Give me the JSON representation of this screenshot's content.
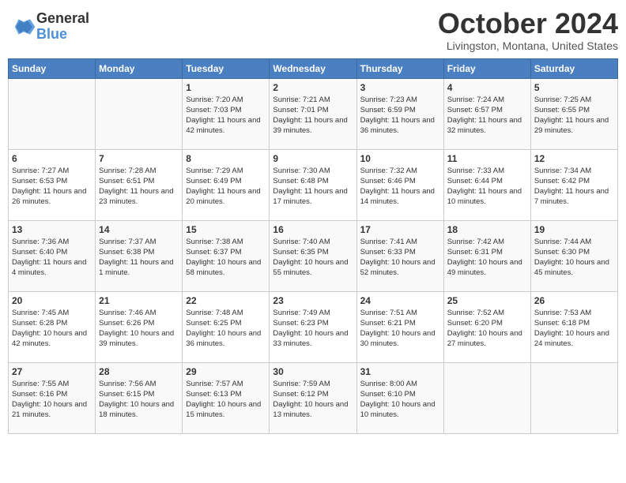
{
  "logo": {
    "general": "General",
    "blue": "Blue"
  },
  "title": "October 2024",
  "location": "Livingston, Montana, United States",
  "days_of_week": [
    "Sunday",
    "Monday",
    "Tuesday",
    "Wednesday",
    "Thursday",
    "Friday",
    "Saturday"
  ],
  "weeks": [
    [
      {
        "day": "",
        "sunrise": "",
        "sunset": "",
        "daylight": ""
      },
      {
        "day": "",
        "sunrise": "",
        "sunset": "",
        "daylight": ""
      },
      {
        "day": "1",
        "sunrise": "Sunrise: 7:20 AM",
        "sunset": "Sunset: 7:03 PM",
        "daylight": "Daylight: 11 hours and 42 minutes."
      },
      {
        "day": "2",
        "sunrise": "Sunrise: 7:21 AM",
        "sunset": "Sunset: 7:01 PM",
        "daylight": "Daylight: 11 hours and 39 minutes."
      },
      {
        "day": "3",
        "sunrise": "Sunrise: 7:23 AM",
        "sunset": "Sunset: 6:59 PM",
        "daylight": "Daylight: 11 hours and 36 minutes."
      },
      {
        "day": "4",
        "sunrise": "Sunrise: 7:24 AM",
        "sunset": "Sunset: 6:57 PM",
        "daylight": "Daylight: 11 hours and 32 minutes."
      },
      {
        "day": "5",
        "sunrise": "Sunrise: 7:25 AM",
        "sunset": "Sunset: 6:55 PM",
        "daylight": "Daylight: 11 hours and 29 minutes."
      }
    ],
    [
      {
        "day": "6",
        "sunrise": "Sunrise: 7:27 AM",
        "sunset": "Sunset: 6:53 PM",
        "daylight": "Daylight: 11 hours and 26 minutes."
      },
      {
        "day": "7",
        "sunrise": "Sunrise: 7:28 AM",
        "sunset": "Sunset: 6:51 PM",
        "daylight": "Daylight: 11 hours and 23 minutes."
      },
      {
        "day": "8",
        "sunrise": "Sunrise: 7:29 AM",
        "sunset": "Sunset: 6:49 PM",
        "daylight": "Daylight: 11 hours and 20 minutes."
      },
      {
        "day": "9",
        "sunrise": "Sunrise: 7:30 AM",
        "sunset": "Sunset: 6:48 PM",
        "daylight": "Daylight: 11 hours and 17 minutes."
      },
      {
        "day": "10",
        "sunrise": "Sunrise: 7:32 AM",
        "sunset": "Sunset: 6:46 PM",
        "daylight": "Daylight: 11 hours and 14 minutes."
      },
      {
        "day": "11",
        "sunrise": "Sunrise: 7:33 AM",
        "sunset": "Sunset: 6:44 PM",
        "daylight": "Daylight: 11 hours and 10 minutes."
      },
      {
        "day": "12",
        "sunrise": "Sunrise: 7:34 AM",
        "sunset": "Sunset: 6:42 PM",
        "daylight": "Daylight: 11 hours and 7 minutes."
      }
    ],
    [
      {
        "day": "13",
        "sunrise": "Sunrise: 7:36 AM",
        "sunset": "Sunset: 6:40 PM",
        "daylight": "Daylight: 11 hours and 4 minutes."
      },
      {
        "day": "14",
        "sunrise": "Sunrise: 7:37 AM",
        "sunset": "Sunset: 6:38 PM",
        "daylight": "Daylight: 11 hours and 1 minute."
      },
      {
        "day": "15",
        "sunrise": "Sunrise: 7:38 AM",
        "sunset": "Sunset: 6:37 PM",
        "daylight": "Daylight: 10 hours and 58 minutes."
      },
      {
        "day": "16",
        "sunrise": "Sunrise: 7:40 AM",
        "sunset": "Sunset: 6:35 PM",
        "daylight": "Daylight: 10 hours and 55 minutes."
      },
      {
        "day": "17",
        "sunrise": "Sunrise: 7:41 AM",
        "sunset": "Sunset: 6:33 PM",
        "daylight": "Daylight: 10 hours and 52 minutes."
      },
      {
        "day": "18",
        "sunrise": "Sunrise: 7:42 AM",
        "sunset": "Sunset: 6:31 PM",
        "daylight": "Daylight: 10 hours and 49 minutes."
      },
      {
        "day": "19",
        "sunrise": "Sunrise: 7:44 AM",
        "sunset": "Sunset: 6:30 PM",
        "daylight": "Daylight: 10 hours and 45 minutes."
      }
    ],
    [
      {
        "day": "20",
        "sunrise": "Sunrise: 7:45 AM",
        "sunset": "Sunset: 6:28 PM",
        "daylight": "Daylight: 10 hours and 42 minutes."
      },
      {
        "day": "21",
        "sunrise": "Sunrise: 7:46 AM",
        "sunset": "Sunset: 6:26 PM",
        "daylight": "Daylight: 10 hours and 39 minutes."
      },
      {
        "day": "22",
        "sunrise": "Sunrise: 7:48 AM",
        "sunset": "Sunset: 6:25 PM",
        "daylight": "Daylight: 10 hours and 36 minutes."
      },
      {
        "day": "23",
        "sunrise": "Sunrise: 7:49 AM",
        "sunset": "Sunset: 6:23 PM",
        "daylight": "Daylight: 10 hours and 33 minutes."
      },
      {
        "day": "24",
        "sunrise": "Sunrise: 7:51 AM",
        "sunset": "Sunset: 6:21 PM",
        "daylight": "Daylight: 10 hours and 30 minutes."
      },
      {
        "day": "25",
        "sunrise": "Sunrise: 7:52 AM",
        "sunset": "Sunset: 6:20 PM",
        "daylight": "Daylight: 10 hours and 27 minutes."
      },
      {
        "day": "26",
        "sunrise": "Sunrise: 7:53 AM",
        "sunset": "Sunset: 6:18 PM",
        "daylight": "Daylight: 10 hours and 24 minutes."
      }
    ],
    [
      {
        "day": "27",
        "sunrise": "Sunrise: 7:55 AM",
        "sunset": "Sunset: 6:16 PM",
        "daylight": "Daylight: 10 hours and 21 minutes."
      },
      {
        "day": "28",
        "sunrise": "Sunrise: 7:56 AM",
        "sunset": "Sunset: 6:15 PM",
        "daylight": "Daylight: 10 hours and 18 minutes."
      },
      {
        "day": "29",
        "sunrise": "Sunrise: 7:57 AM",
        "sunset": "Sunset: 6:13 PM",
        "daylight": "Daylight: 10 hours and 15 minutes."
      },
      {
        "day": "30",
        "sunrise": "Sunrise: 7:59 AM",
        "sunset": "Sunset: 6:12 PM",
        "daylight": "Daylight: 10 hours and 13 minutes."
      },
      {
        "day": "31",
        "sunrise": "Sunrise: 8:00 AM",
        "sunset": "Sunset: 6:10 PM",
        "daylight": "Daylight: 10 hours and 10 minutes."
      },
      {
        "day": "",
        "sunrise": "",
        "sunset": "",
        "daylight": ""
      },
      {
        "day": "",
        "sunrise": "",
        "sunset": "",
        "daylight": ""
      }
    ]
  ]
}
